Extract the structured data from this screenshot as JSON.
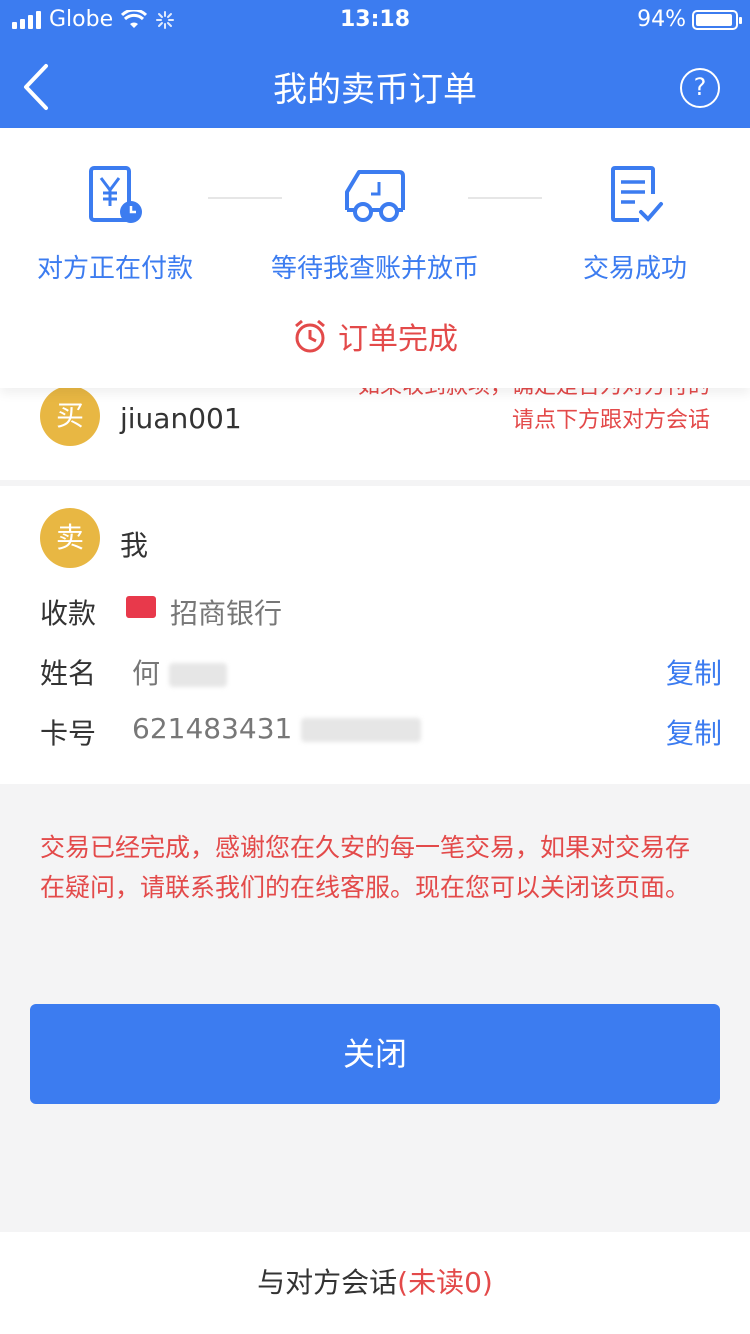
{
  "status_bar": {
    "carrier": "Globe",
    "time": "13:18",
    "battery": "94%",
    "battery_level": 0.94
  },
  "nav": {
    "title": "我的卖币订单",
    "help_label": "?"
  },
  "steps": [
    {
      "label": "对方正在付款",
      "icon": "yen-clock-icon"
    },
    {
      "label": "等待我查账并放币",
      "icon": "truck-icon"
    },
    {
      "label": "交易成功",
      "icon": "document-check-icon"
    }
  ],
  "order_status": "订单完成",
  "buyer": {
    "badge": "买",
    "name": "jiuan001",
    "note_line1": "如果收到款项，确定是否为对方付的",
    "note_line2": "请点下方跟对方会话"
  },
  "seller": {
    "badge": "卖",
    "name": "我",
    "payment_label": "收款",
    "bank": "招商银行",
    "name_label": "姓名",
    "name_value": "何",
    "card_label": "卡号",
    "card_value": "621483431",
    "copy_label": "复制"
  },
  "notice": "交易已经完成，感谢您在久安的每一笔交易，如果对交易存在疑问，请联系我们的在线客服。现在您可以关闭该页面。",
  "close_button": "关闭",
  "chat": {
    "label": "与对方会话",
    "unread": "(未读0)"
  },
  "colors": {
    "primary": "#3c7cf0",
    "alert": "#e34a4a",
    "avatar": "#e8b743",
    "bank_card": "#e8394b"
  }
}
